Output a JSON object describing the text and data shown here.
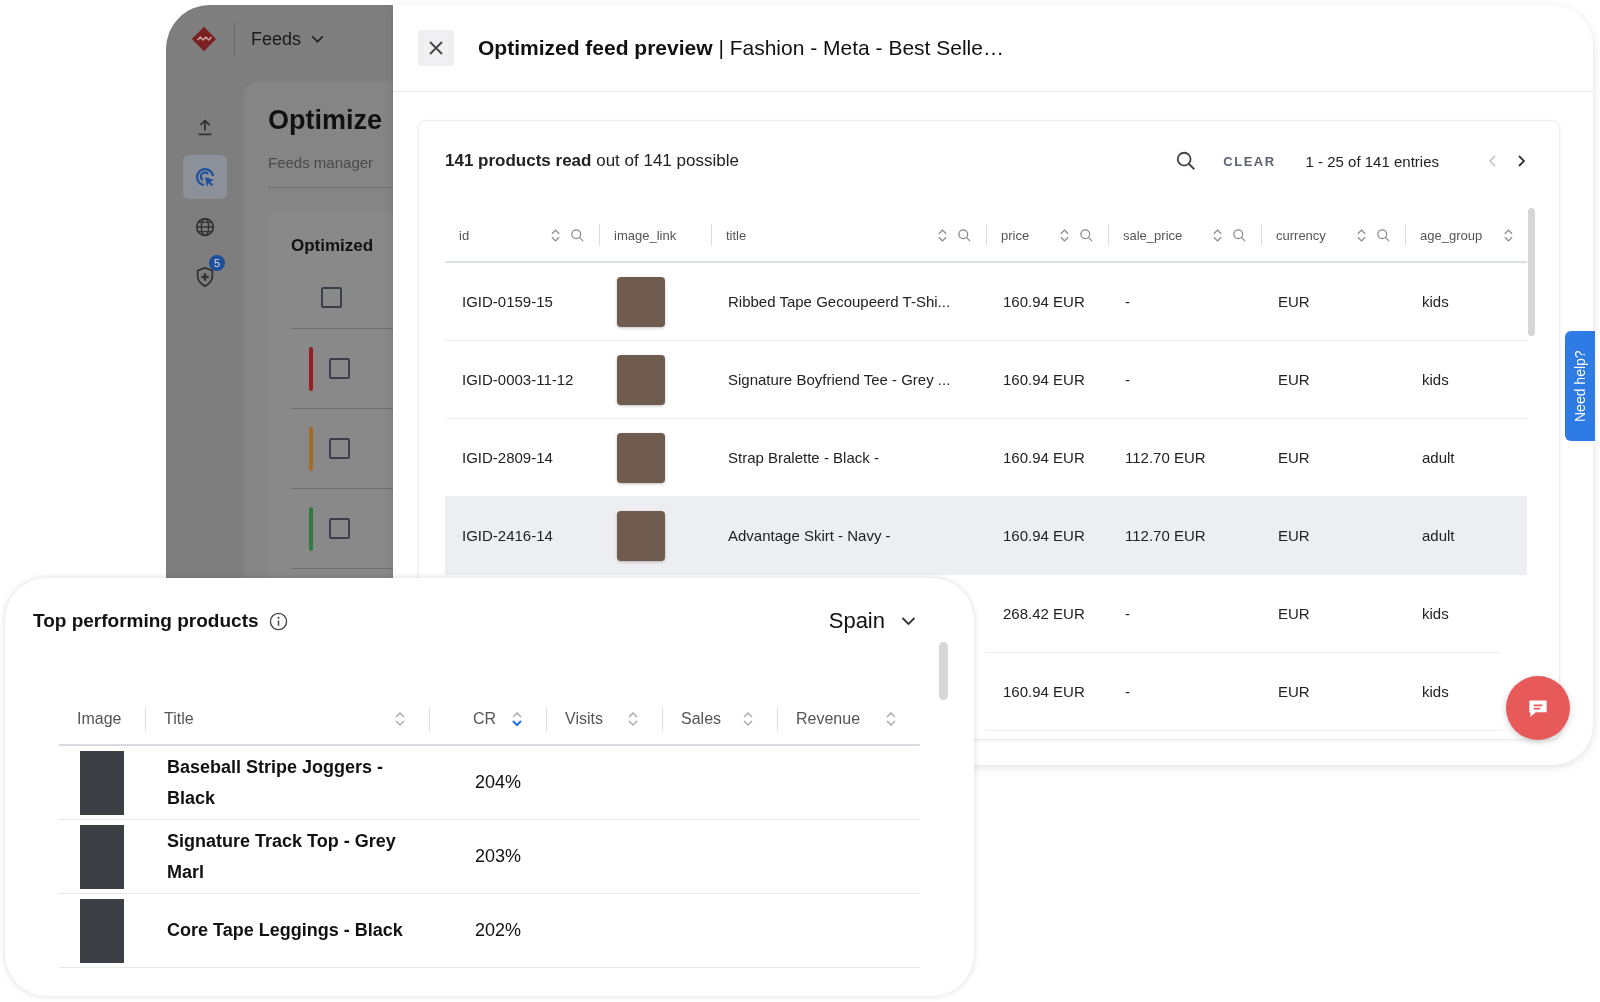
{
  "back_window": {
    "menu": {
      "label": "Feeds"
    },
    "sidebar": [
      {
        "kind": "upload",
        "selected": false
      },
      {
        "kind": "target",
        "selected": true
      },
      {
        "kind": "globe",
        "selected": false
      },
      {
        "kind": "shield",
        "selected": false,
        "badge": "5"
      }
    ],
    "page_title": "Optimize",
    "breadcrumb": "Feeds manager",
    "card": {
      "title": "Optimized",
      "select_all_checked": false,
      "rows": [
        {
          "color": "#9b1c1c",
          "checked": false
        },
        {
          "color": "#a86a1f",
          "checked": false
        },
        {
          "color": "#2e7d3e",
          "checked": false
        }
      ]
    }
  },
  "preview": {
    "title": "Optimized feed preview",
    "separator": "|",
    "subtitle": "Fashion - Meta - Best Selle…",
    "summary": "**141 products read** out of 141 possible",
    "clear": "CLEAR",
    "range": "1 - 25 of 141 entries",
    "prev_enabled": false,
    "next_enabled": true,
    "columns": [
      {
        "label": "id",
        "sortable": true,
        "searchable": true
      },
      {
        "label": "image_link",
        "sortable": false,
        "searchable": false
      },
      {
        "label": "title",
        "sortable": true,
        "searchable": true
      },
      {
        "label": "price",
        "sortable": true,
        "searchable": true
      },
      {
        "label": "sale_price",
        "sortable": true,
        "searchable": true
      },
      {
        "label": "currency",
        "sortable": true,
        "searchable": true
      },
      {
        "label": "age_group",
        "sortable": true,
        "searchable": false
      }
    ],
    "rows": [
      {
        "id": "IGID-0159-15",
        "title": "Ribbed Tape Gecoupeerd T-Shi...",
        "price": "160.94 EUR",
        "sale_price": "-",
        "currency": "EUR",
        "age_group": "kids",
        "selected": false
      },
      {
        "id": "IGID-0003-11-12",
        "title": "Signature Boyfriend Tee - Grey ...",
        "price": "160.94 EUR",
        "sale_price": "-",
        "currency": "EUR",
        "age_group": "kids",
        "selected": false
      },
      {
        "id": "IGID-2809-14",
        "title": "Strap Bralette - Black -",
        "price": "160.94 EUR",
        "sale_price": "112.70 EUR",
        "currency": "EUR",
        "age_group": "adult",
        "selected": false
      },
      {
        "id": "IGID-2416-14",
        "title": "Advantage Skirt - Navy -",
        "price": "160.94 EUR",
        "sale_price": "112.70 EUR",
        "currency": "EUR",
        "age_group": "adult",
        "selected": true
      },
      {
        "price": "268.42 EUR",
        "sale_price": "-",
        "currency": "EUR",
        "age_group": "kids",
        "selected": false
      },
      {
        "price": "160.94 EUR",
        "sale_price": "-",
        "currency": "EUR",
        "age_group": "kids",
        "selected": false
      }
    ]
  },
  "help_tab": {
    "label": "Need help?"
  },
  "top_products": {
    "title": "Top performing products",
    "region": "Spain",
    "columns": [
      {
        "label": "Image"
      },
      {
        "label": "Title",
        "sorted_desc": false
      },
      {
        "label": "CR",
        "sorted_desc": true
      },
      {
        "label": "Visits",
        "sorted_desc": false
      },
      {
        "label": "Sales",
        "sorted_desc": false
      },
      {
        "label": "Revenue",
        "sorted_desc": false
      }
    ],
    "rows": [
      {
        "title": "Baseball Stripe Joggers - Black",
        "cr": "204%"
      },
      {
        "title": "Signature Track Top - Grey Marl",
        "cr": "203%"
      },
      {
        "title": "Core Tape Leggings - Black",
        "cr": "202%"
      }
    ]
  }
}
